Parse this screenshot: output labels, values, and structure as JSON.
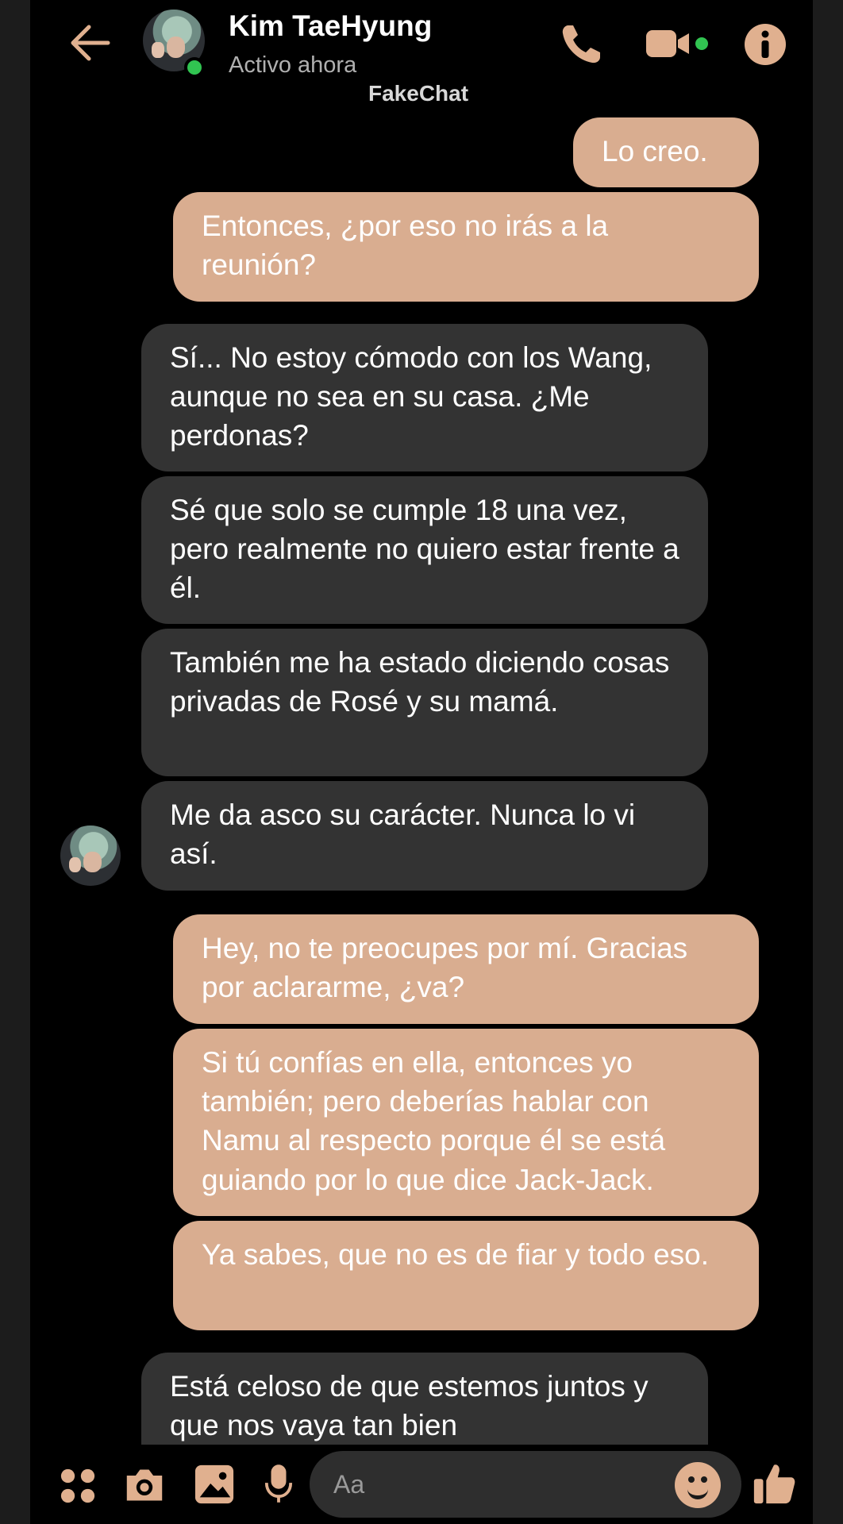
{
  "header": {
    "contact_name": "Kim TaeHyung",
    "status": "Activo ahora",
    "watermark": "FakeChat",
    "icons": [
      "back-arrow-icon",
      "phone-icon",
      "video-camera-icon",
      "info-icon"
    ]
  },
  "messages": [
    {
      "side": "out",
      "text": "Lo creo."
    },
    {
      "side": "out",
      "text": "Entonces, ¿por eso no irás a la reunión?"
    },
    {
      "side": "in",
      "text": "Sí... No estoy cómodo con los Wang, aunque no sea en su casa. ¿Me perdonas?"
    },
    {
      "side": "in",
      "text": "Sé que solo se cumple 18 una vez, pero realmente no quiero estar frente a él."
    },
    {
      "side": "in",
      "text": "También me ha estado diciendo cosas privadas de Rosé y su mamá."
    },
    {
      "side": "in",
      "text": "Me da asco su carácter. Nunca lo vi así."
    },
    {
      "side": "out",
      "text": "Hey, no te preocupes por mí. Gracias por aclararme, ¿va?"
    },
    {
      "side": "out",
      "text": "Si tú confías en ella, entonces yo también; pero deberías hablar con Namu al respecto porque él se está guiando por lo que dice Jack-Jack."
    },
    {
      "side": "out",
      "text": "Ya sabes, que no es de fiar y todo eso."
    },
    {
      "side": "in",
      "text": "Está celoso de que estemos juntos y que nos vaya tan bien"
    }
  ],
  "composer": {
    "placeholder": "Aa",
    "icons": [
      "apps-grid-icon",
      "camera-icon",
      "gallery-icon",
      "microphone-icon",
      "emoji-icon",
      "thumbs-up-icon"
    ]
  },
  "colors": {
    "outgoing_bubble": "#d9ad90",
    "incoming_bubble": "#333333",
    "accent": "#e0b08f",
    "online": "#31c451",
    "background": "#000000"
  }
}
